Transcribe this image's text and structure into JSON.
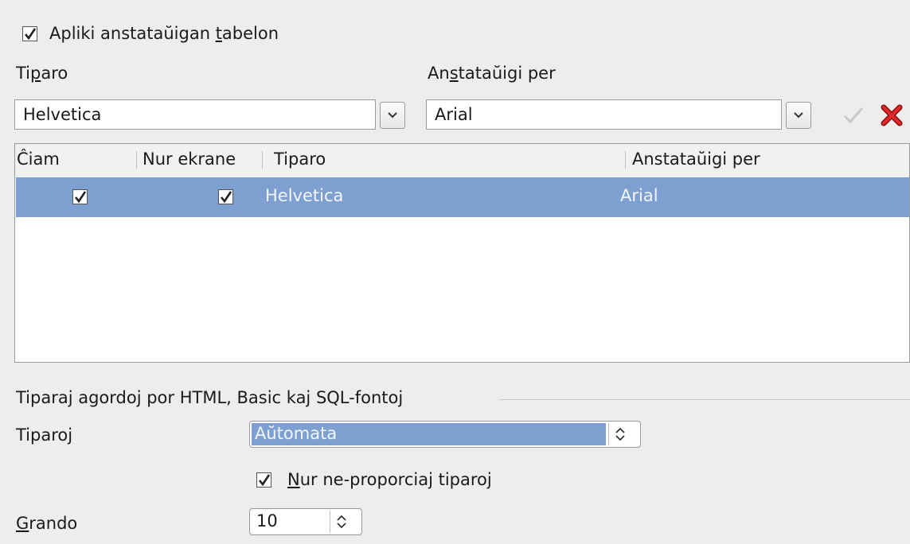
{
  "top_option": {
    "label_pre": "Apliki anstataŭigan ",
    "label_mnemonic": "t",
    "label_post": "abelon",
    "checked": true
  },
  "font_label": {
    "pre": "Ti",
    "mnemonic": "p",
    "post": "aro"
  },
  "replace_label": {
    "pre": "An",
    "mnemonic": "s",
    "post": "tataŭigi per"
  },
  "font_combo": {
    "value": "Helvetica"
  },
  "replace_combo": {
    "value": "Arial"
  },
  "actions": {
    "apply_icon": "checkmark-icon",
    "delete_icon": "delete-x-icon"
  },
  "table": {
    "columns": [
      "Ĉiam",
      "Nur ekrane",
      "Tiparo",
      "Anstataŭigi per"
    ],
    "rows": [
      {
        "always": true,
        "screen_only": true,
        "font": "Helvetica",
        "replace_with": "Arial",
        "selected": true
      }
    ]
  },
  "section": {
    "title": "Tiparaj agordoj por HTML, Basic kaj SQL-fontoj",
    "fonts_label": {
      "pre": "Tiparo",
      "mnemonic": "j"
    },
    "fonts_value": "Aŭtomata",
    "nonprop": {
      "mnemonic": "N",
      "post": "ur ne-proporciaj tiparoj",
      "checked": true
    },
    "size_label": {
      "mnemonic": "G",
      "post": "rando"
    },
    "size_value": "10"
  },
  "colors": {
    "selection": "#7ea0d1",
    "delete": "#d42020",
    "background": "#ededed"
  }
}
